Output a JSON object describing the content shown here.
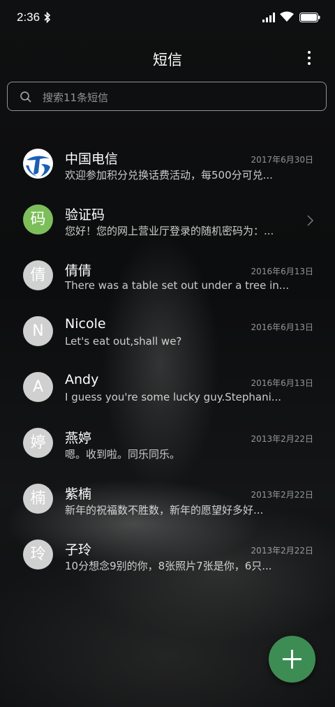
{
  "status": {
    "time": "2:36"
  },
  "header": {
    "title": "短信"
  },
  "search": {
    "placeholder": "搜索11条短信"
  },
  "conversations": [
    {
      "name": "中国电信",
      "date": "2017年6月30日",
      "preview": "欢迎参加积分兑换话费活动，每500分可兑...",
      "avatar": "",
      "avatar_type": "logo"
    },
    {
      "name": "验证码",
      "date": "",
      "preview": "您好！您的网上营业厅登录的随机密码为：...",
      "avatar": "码",
      "avatar_type": "green"
    },
    {
      "name": "倩倩",
      "date": "2016年6月13日",
      "preview": "There was a table set out under a tree in...",
      "avatar": "倩",
      "avatar_type": "letter"
    },
    {
      "name": "Nicole",
      "date": "2016年6月13日",
      "preview": "Let's eat out,shall we?",
      "avatar": "N",
      "avatar_type": "letter"
    },
    {
      "name": "Andy",
      "date": "2016年6月13日",
      "preview": "I guess you're some lucky guy.Stephani...",
      "avatar": "A",
      "avatar_type": "letter"
    },
    {
      "name": "燕婷",
      "date": "2013年2月22日",
      "preview": "嗯。收到啦。同乐同乐。",
      "avatar": "婷",
      "avatar_type": "letter"
    },
    {
      "name": "紫楠",
      "date": "2013年2月22日",
      "preview": "新年的祝福数不胜数，新年的愿望好多好...",
      "avatar": "楠",
      "avatar_type": "letter"
    },
    {
      "name": "子玲",
      "date": "2013年2月22日",
      "preview": "10分想念9别的你，8张照片7张是你，6只...",
      "avatar": "玲",
      "avatar_type": "letter"
    }
  ],
  "colors": {
    "fab": "#3d8c54",
    "avatar_green": "#7cbf5a",
    "telecom_blue": "#1a5fb4"
  },
  "icons": {
    "status": [
      "bluetooth-icon",
      "signal-icon",
      "wifi-icon",
      "battery-icon"
    ],
    "header": "more-vertical-icon",
    "search": "search-icon",
    "fab": "plus-icon",
    "row_chevron": "chevron-right-icon"
  }
}
